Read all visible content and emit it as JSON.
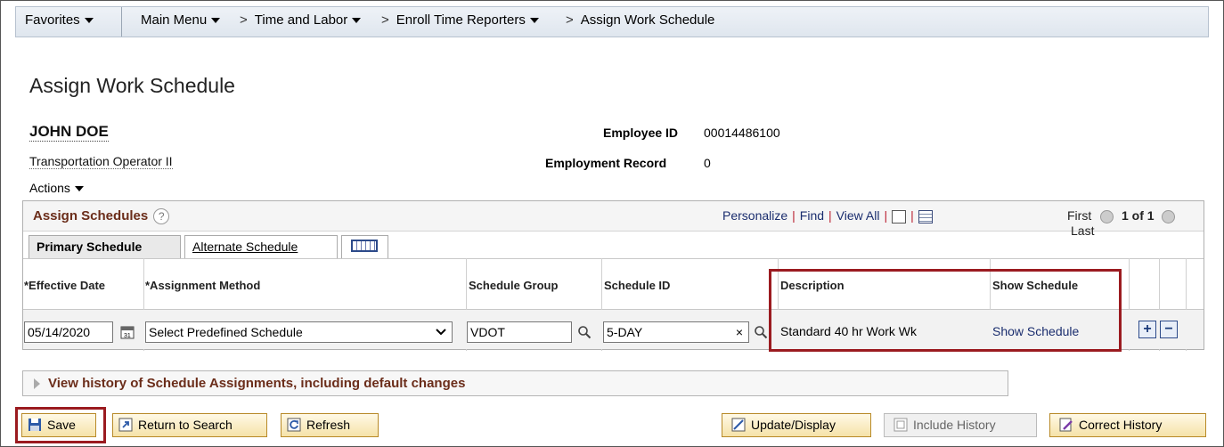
{
  "nav": {
    "favorites": "Favorites",
    "main_menu": "Main Menu",
    "time_labor": "Time and Labor",
    "enroll": "Enroll Time Reporters",
    "current": "Assign Work Schedule",
    "sep": ">"
  },
  "page": {
    "title": "Assign Work Schedule"
  },
  "employee": {
    "name": "JOHN DOE",
    "job_title": "Transportation Operator II",
    "id_label": "Employee ID",
    "id_value": "00014486100",
    "record_label": "Employment Record",
    "record_value": "0",
    "actions": "Actions"
  },
  "grid": {
    "title": "Assign Schedules",
    "help": "?",
    "personalize": "Personalize",
    "find": "Find",
    "view_all": "View All",
    "sep": "|",
    "first": "First",
    "count": "1 of 1",
    "last": "Last",
    "tabs": {
      "primary": "Primary Schedule",
      "alternate": "Alternate Schedule"
    },
    "columns": {
      "effective_date": "*Effective Date",
      "assignment_method": "*Assignment Method",
      "schedule_group": "Schedule Group",
      "schedule_id": "Schedule ID",
      "description": "Description",
      "show_schedule": "Show Schedule"
    },
    "row": {
      "effective_date": "05/14/2020",
      "assignment_method": "Select Predefined Schedule",
      "schedule_group": "VDOT",
      "schedule_id": "5-DAY",
      "clear": "×",
      "description": "Standard 40 hr Work Wk",
      "show_schedule": "Show Schedule",
      "add": "+",
      "remove": "−"
    }
  },
  "history": {
    "label": "View history of Schedule Assignments, including default changes"
  },
  "buttons": {
    "save": "Save",
    "return": "Return to Search",
    "refresh": "Refresh",
    "update": "Update/Display",
    "include_history": "Include History",
    "correct_history": "Correct History"
  },
  "colors": {
    "highlight": "#9b1b20",
    "section_title": "#6b2d1a",
    "link": "#1a2d6e"
  }
}
